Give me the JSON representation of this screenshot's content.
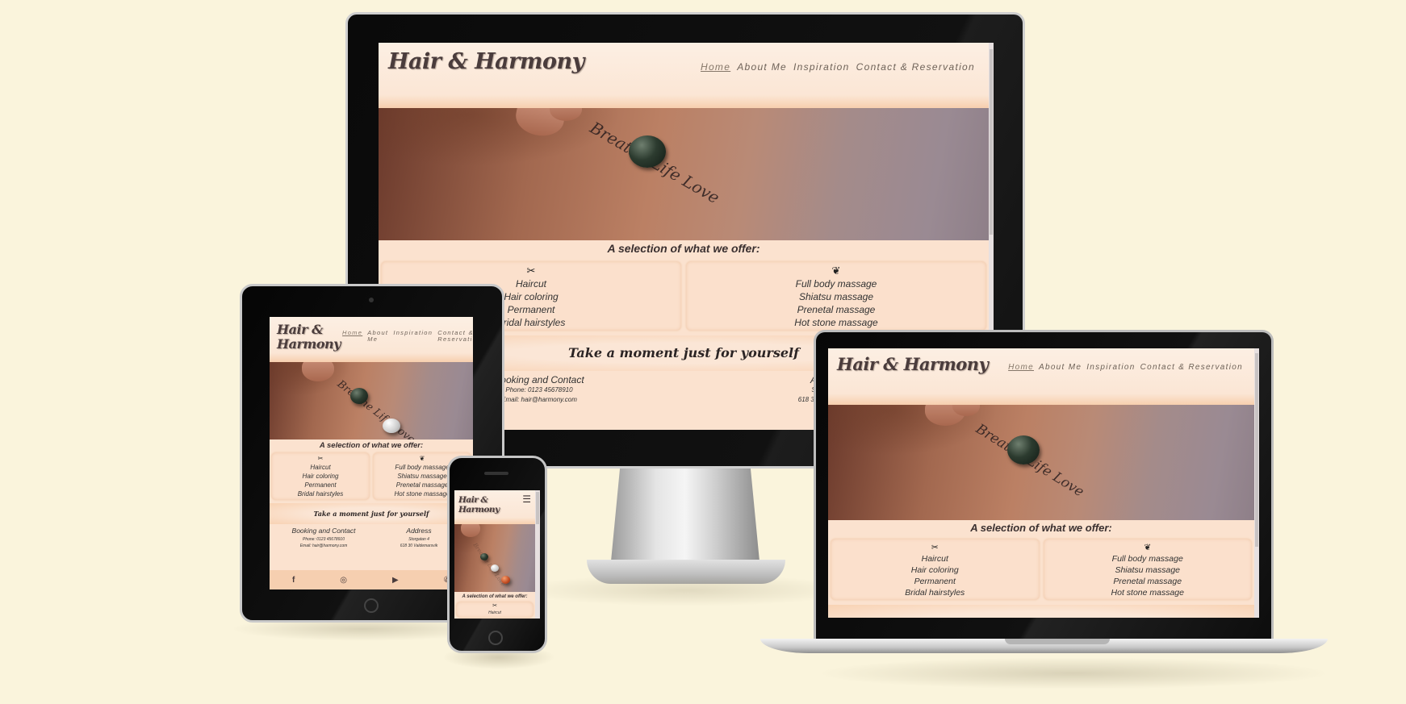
{
  "site": {
    "logo": "Hair & Harmony",
    "logo_line1": "Hair &",
    "logo_line2": "Harmony",
    "nav": {
      "home": "Home",
      "about": "About Me",
      "about_line1": "About",
      "about_line2": "Me",
      "inspiration": "Inspiration",
      "contact": "Contact & Reservation",
      "contact_line1": "Contact &",
      "contact_line2": "Reservation"
    },
    "hero_tattoo_text": "Breathe Life Love",
    "offer_title": "A selection of what we offer:",
    "hair_icon": "scissors-icon",
    "hair_icon_glyph": "✂",
    "hair_services": [
      "Haircut",
      "Hair coloring",
      "Permanent",
      "Bridal hairstyles"
    ],
    "massage_icon": "lotus-icon",
    "massage_icon_glyph": "❦",
    "massage_services": [
      "Full body massage",
      "Shiatsu massage",
      "Prenetal massage",
      "Hot stone massage"
    ],
    "band_text": "Take a moment just for yourself",
    "contact": {
      "heading": "Booking and Contact",
      "phone": "Phone: 0123 45678910",
      "email": "Email: hair@harmony.com"
    },
    "address": {
      "heading": "Address",
      "line1": "Storgatan 4",
      "line2": "618 30 Valdemarsvik"
    },
    "footer_icons": [
      "facebook-icon",
      "instagram-icon",
      "youtube-icon",
      "phone-icon"
    ],
    "footer_glyphs": [
      "f",
      "◎",
      "▶",
      "✆"
    ],
    "menu_glyph": "☰"
  },
  "colors": {
    "background": "#faf4dc",
    "site_bg": "#fbe2cf",
    "header_bg": "#fcefe3",
    "accent": "#f6cfb0",
    "text_dark": "#3a3030"
  }
}
